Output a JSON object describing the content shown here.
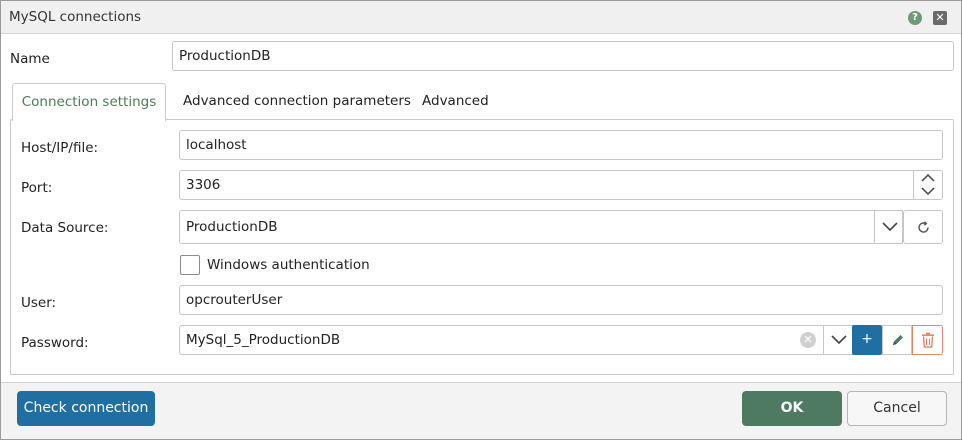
{
  "window": {
    "title": "MySQL connections"
  },
  "icons": {
    "help": "help-icon",
    "close": "close-icon"
  },
  "name": {
    "label": "Name",
    "value": "ProductionDB"
  },
  "tabs": [
    {
      "label": "Connection settings",
      "active": true
    },
    {
      "label": "Advanced connection parameters",
      "active": false
    },
    {
      "label": "Advanced",
      "active": false
    }
  ],
  "host": {
    "label": "Host/IP/file:",
    "value": "localhost"
  },
  "port": {
    "label": "Port:",
    "value": "3306"
  },
  "datasource": {
    "label": "Data Source:",
    "value": "ProductionDB"
  },
  "winauth": {
    "label": "Windows authentication",
    "checked": false
  },
  "user": {
    "label": "User:",
    "value": "opcrouterUser"
  },
  "password": {
    "label": "Password:",
    "value": "MySql_5_ProductionDB",
    "add_glyph": "+"
  },
  "footer": {
    "check_label": "Check connection",
    "ok_label": "OK",
    "cancel_label": "Cancel"
  },
  "colors": {
    "primary": "#1f6fa3",
    "ok": "#4f7a62",
    "active_tab_text": "#4d7a5a",
    "delete_border": "#e08a6a"
  }
}
